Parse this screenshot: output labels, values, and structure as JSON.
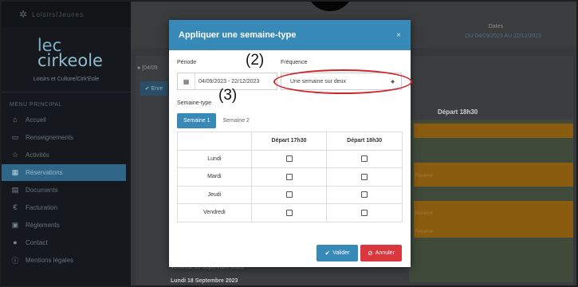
{
  "sidebar": {
    "top_label": "Loisirs/Jeunes",
    "logo_line1": "lec",
    "logo_line2": "cirkeole",
    "subtitle": "Loisirs et Culture/Cirk'Eole",
    "menu_title": "MENU PRINCIPAL",
    "items": [
      {
        "label": "Accueil",
        "icon": "home-icon"
      },
      {
        "label": "Renseignements",
        "icon": "folder-icon"
      },
      {
        "label": "Activités",
        "icon": "star-icon"
      },
      {
        "label": "Réservations",
        "icon": "calendar-icon",
        "active": true
      },
      {
        "label": "Documents",
        "icon": "document-icon"
      },
      {
        "label": "Facturation",
        "icon": "euro-icon"
      },
      {
        "label": "Règlements",
        "icon": "payment-icon"
      },
      {
        "label": "Contact",
        "icon": "chat-icon"
      },
      {
        "label": "Mentions légales",
        "icon": "info-icon"
      }
    ]
  },
  "main": {
    "dates_title": "Dates",
    "dates_value": "DU 04/09/2023 AU 22/12/2023",
    "info_text": "[04/09",
    "small_button": "Enre",
    "column_header": "Départ 18h30",
    "band_label": "Réservé",
    "day_label_top": "Vendredi 15 Septembre 2023",
    "day_label": "Lundi 18 Septembre 2023"
  },
  "modal": {
    "title": "Appliquer une semaine-type",
    "close": "×",
    "period_label": "Période",
    "period_value": "04/09/2023 - 22/12/2023",
    "frequency_label": "Fréquence",
    "frequency_value": "Une semaine sur deux",
    "week_type_label": "Semaine-type",
    "tabs": [
      {
        "label": "Semaine 1",
        "active": true
      },
      {
        "label": "Semaine 2",
        "active": false
      }
    ],
    "columns": [
      "Départ 17h30",
      "Départ 18h30"
    ],
    "rows": [
      "Lundi",
      "Mardi",
      "Jeudi",
      "Vendredi"
    ],
    "validate_label": "Valider",
    "cancel_label": "Annuler"
  },
  "annotations": {
    "label_2": "(2)",
    "label_3": "(3)",
    "ellipse_color": "#d0242b"
  },
  "colors": {
    "primary": "#3789b7",
    "danger": "#d9363e",
    "sidebar_active": "#2f6688"
  }
}
